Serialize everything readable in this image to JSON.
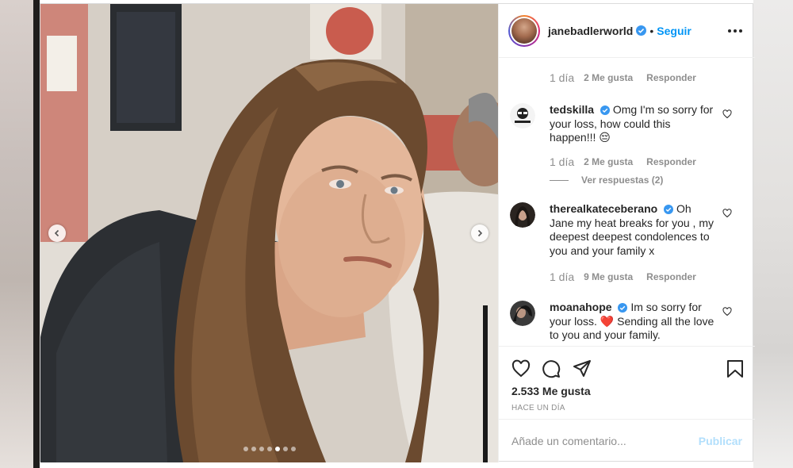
{
  "post": {
    "username": "janebadlerworld",
    "separator": "•",
    "follow_label": "Seguir",
    "likes_text": "2.533 Me gusta",
    "time_ago": "HACE UN DÍA",
    "photo_count": 7,
    "active_photo": 5
  },
  "comments": {
    "top_meta": {
      "time": "1 día",
      "likes": "2 Me gusta",
      "reply": "Responder"
    },
    "items": [
      {
        "username": "tedskilla",
        "text": "Omg I'm so sorry for your loss, how could this happen!!! 😔",
        "time": "1 día",
        "likes": "2 Me gusta",
        "reply": "Responder",
        "view_replies": "Ver respuestas (2)"
      },
      {
        "username": "therealkateceberano",
        "text": "Oh Jane my heat breaks for you , my deepest deepest condolences to you and your family x",
        "time": "1 día",
        "likes": "9 Me gusta",
        "reply": "Responder"
      },
      {
        "username": "moanahope",
        "text": "Im so sorry for your loss. ❤️ Sending all the love to you and your family."
      }
    ]
  },
  "composer": {
    "placeholder": "Añade un comentario...",
    "publish_label": "Publicar"
  },
  "icons": {
    "like": "heart-icon",
    "comment": "comment-icon",
    "share": "share-icon",
    "save": "bookmark-icon",
    "more": "more-options-icon",
    "verified": "verified-badge-icon"
  },
  "colors": {
    "link_blue": "#0095f6",
    "publish_disabled": "#b2dffc",
    "muted": "#8e8e8e",
    "text": "#262626"
  }
}
